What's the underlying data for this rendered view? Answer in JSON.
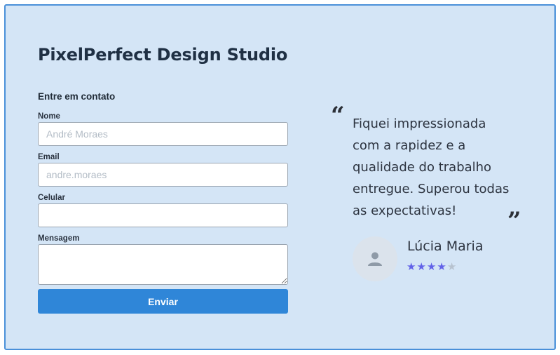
{
  "studio": {
    "name": "PixelPerfect Design Studio"
  },
  "form": {
    "heading": "Entre em contato",
    "name_label": "Nome",
    "name_placeholder": "André Moraes",
    "email_label": "Email",
    "email_placeholder": "andre.moraes",
    "phone_label": "Celular",
    "phone_placeholder": "",
    "message_label": "Mensagem",
    "message_placeholder": "",
    "submit_label": "Enviar"
  },
  "testimonial": {
    "open_quote": "“",
    "close_quote": "”",
    "text": "Fiquei impressionada com a rapidez e a qualidade do trabalho entregue. Superou todas as expectativas!",
    "author": "Lúcia Maria",
    "rating": 4,
    "max_rating": 5,
    "avatar_icon": "user-silhouette-icon"
  },
  "colors": {
    "background": "#d4e5f6",
    "border": "#4a90d9",
    "button": "#2f86d8",
    "star_filled": "#6262e8",
    "star_empty": "#b7c2cf"
  }
}
